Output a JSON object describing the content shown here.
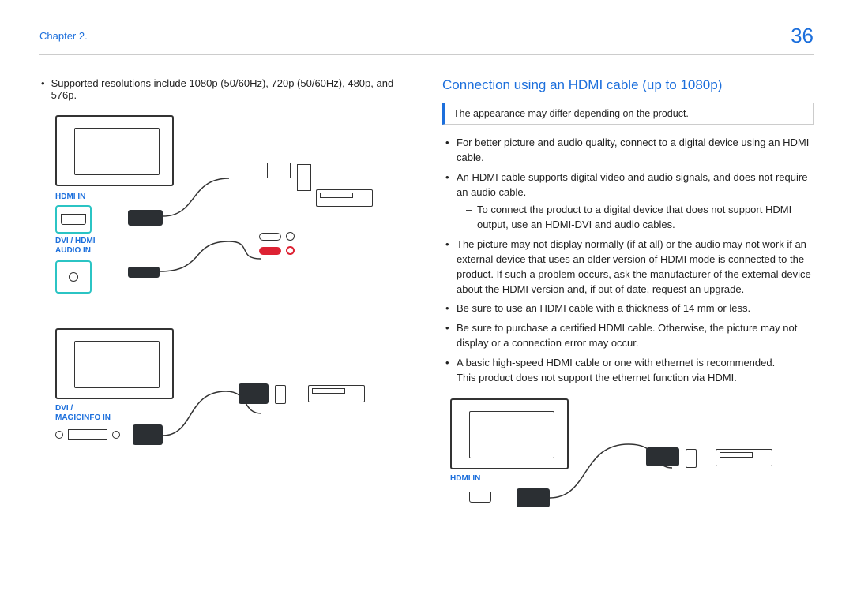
{
  "header": {
    "chapter": "Chapter 2.",
    "page": "36"
  },
  "left": {
    "resolutions": "Supported resolutions include 1080p (50/60Hz), 720p (50/60Hz), 480p, and 576p.",
    "label_hdmi_in": "HDMI IN",
    "label_dvi_hdmi_audio": "DVI / HDMI\nAUDIO IN",
    "label_dvi_magicinfo": "DVI /\nMAGICINFO IN"
  },
  "right": {
    "title": "Connection using an HDMI cable (up to 1080p)",
    "note": "The appearance may differ depending on the product.",
    "bullets": [
      "For better picture and audio quality, connect to a digital device using an HDMI cable.",
      "An HDMI cable supports digital video and audio signals, and does not require an audio cable.",
      "The picture may not display normally (if at all) or the audio may not work if an external device that uses an older version of HDMI mode is connected to the product. If such a problem occurs, ask the manufacturer of the external device about the HDMI version and, if out of date, request an upgrade.",
      "Be sure to use an HDMI cable with a thickness of 14 mm or less.",
      "Be sure to purchase a certified HDMI cable. Otherwise, the picture may not display or a connection error may occur.",
      "A basic high-speed HDMI cable or one with ethernet is recommended.\nThis product does not support the ethernet function via HDMI."
    ],
    "sub_bullet": "To connect the product to a digital device that does not support HDMI output, use an HDMI-DVI and audio cables.",
    "label_hdmi_in": "HDMI IN"
  }
}
